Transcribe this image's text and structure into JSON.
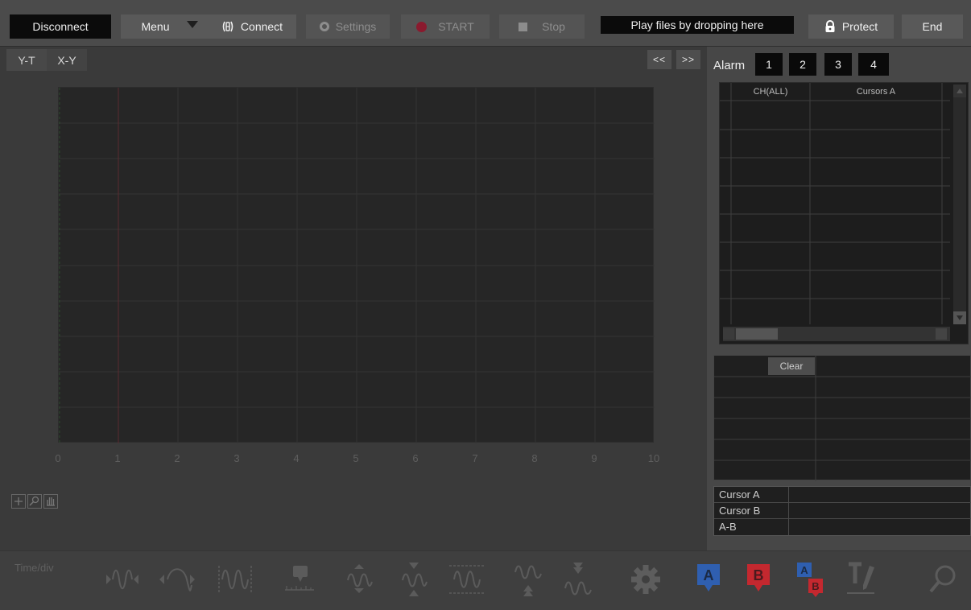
{
  "toolbar": {
    "disconnect": "Disconnect",
    "menu": "Menu",
    "connect": "Connect",
    "settings": "Settings",
    "start": "START",
    "stop": "Stop",
    "drop_zone": "Play files by dropping here",
    "protect": "Protect",
    "end": "End"
  },
  "tabs": {
    "yt": "Y-T",
    "xy": "X-Y"
  },
  "nav": {
    "prev": "<<",
    "next": ">>"
  },
  "plot": {
    "x_ticks": [
      "0",
      "1",
      "2",
      "3",
      "4",
      "5",
      "6",
      "7",
      "8",
      "9",
      "10"
    ]
  },
  "alarm": {
    "label": "Alarm",
    "buttons": [
      "1",
      "2",
      "3",
      "4"
    ]
  },
  "data_table": {
    "columns": [
      "CH(ALL)",
      "Cursors A"
    ]
  },
  "marker_table": {
    "clear": "Clear"
  },
  "cursor_table": {
    "rows": [
      "Cursor A",
      "Cursor B",
      "A-B"
    ]
  },
  "bottom": {
    "time_div": "Time/div"
  },
  "colors": {
    "accent_red": "#8a1a2e",
    "accent_blue": "#2f5fb0",
    "accent_red_b": "#c4282f"
  },
  "icons": [
    "expand-waveform-icon",
    "compress-waveform-icon",
    "fit-waveform-icon",
    "comment-icon",
    "move-up-down-icon",
    "shrink-vertical-icon",
    "fit-vertical-icon",
    "position-up-icon",
    "position-down-icon",
    "settings-gear-icon",
    "cursor-a-icon",
    "cursor-b-icon",
    "cursor-ab-icon",
    "text-annotate-icon",
    "search-icon"
  ]
}
